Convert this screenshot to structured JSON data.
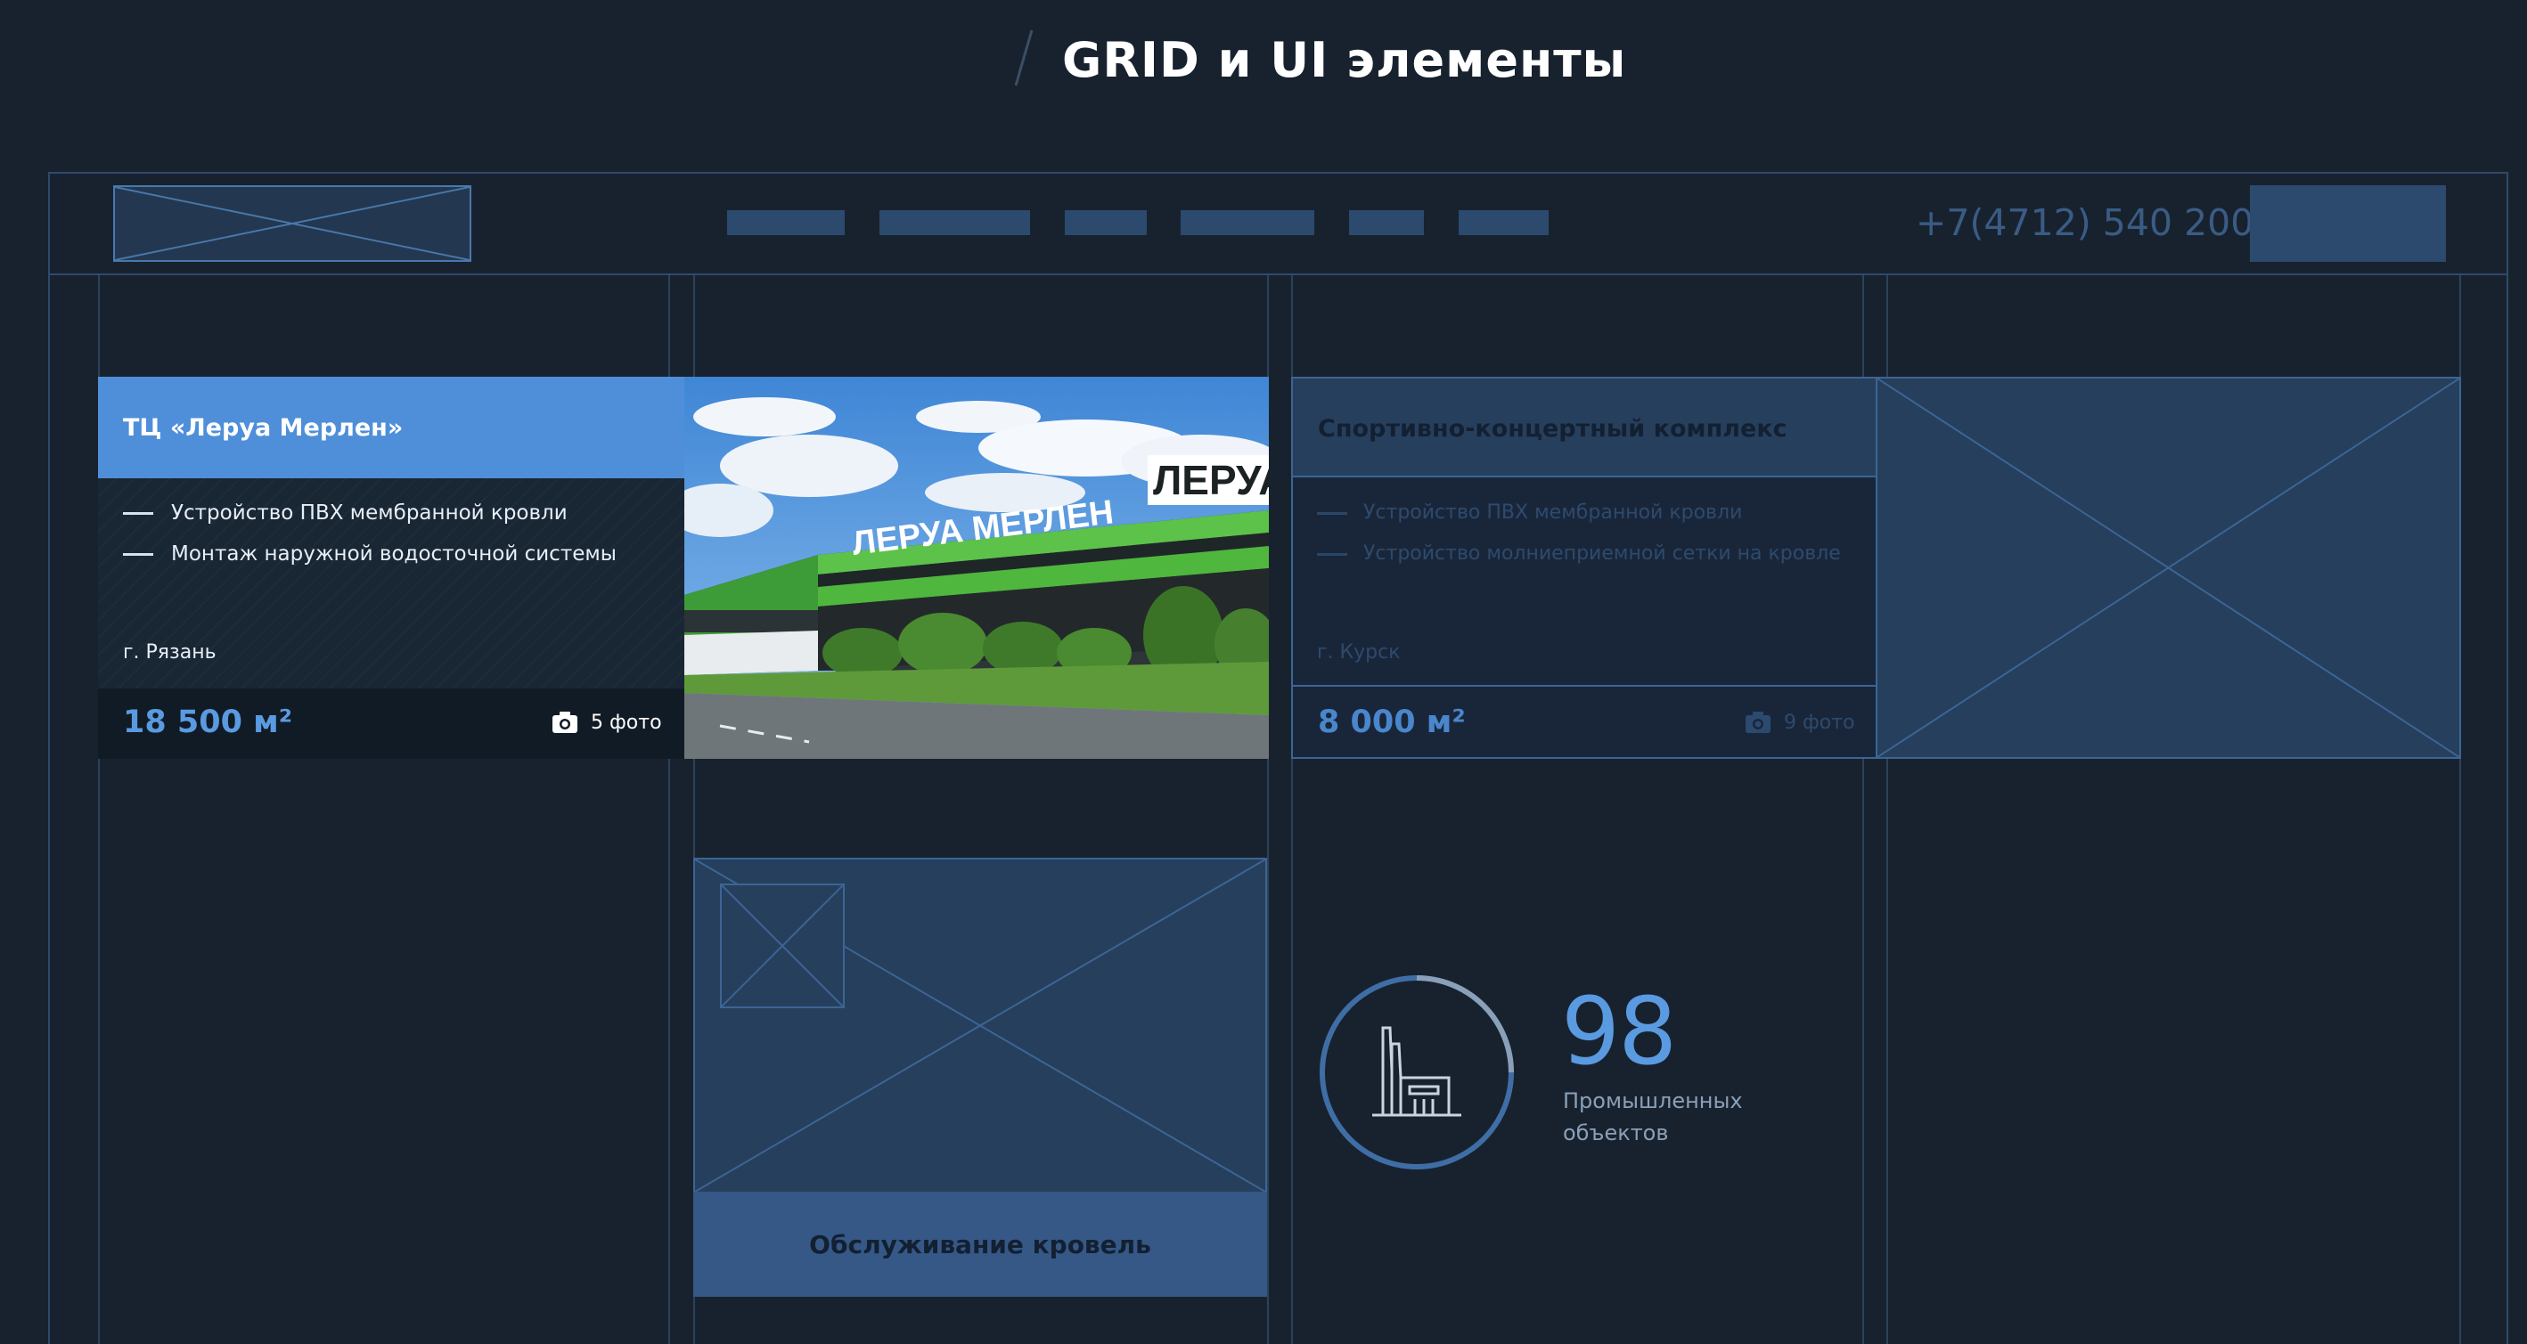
{
  "page": {
    "title": "GRID и UI элементы"
  },
  "header": {
    "phone": "+7(4712) 540 200",
    "nav_items_count_visual": 6
  },
  "project_card": {
    "title": "ТЦ «Леруа Мерлен»",
    "services": [
      "Устройство ПВХ мембранной кровли",
      "Монтаж наружной водосточной системы"
    ],
    "city": "г. Рязань",
    "area": "18 500 м²",
    "photos": "5 фото",
    "photo_sign": "ЛЕРУА МЕРЛЕН",
    "photo_sign_tower": "ЛЕРУА"
  },
  "project_card_inactive": {
    "title": "Спортивно-концертный комплекс",
    "services": [
      "Устройство ПВХ мембранной кровли",
      "Устройство молниеприемной сетки на кровле"
    ],
    "city": "г. Курск",
    "area": "8 000 м²",
    "photos": "9 фото"
  },
  "service_card": {
    "label": "Обслуживание кровель"
  },
  "counter": {
    "value": "98",
    "label": "Промышленных объектов",
    "icon": "factory-icon"
  },
  "colors": {
    "background": "#18222e",
    "accent": "#4f8fd9",
    "wireframe": "#2e4a6a",
    "placeholder": "#263f5c"
  }
}
